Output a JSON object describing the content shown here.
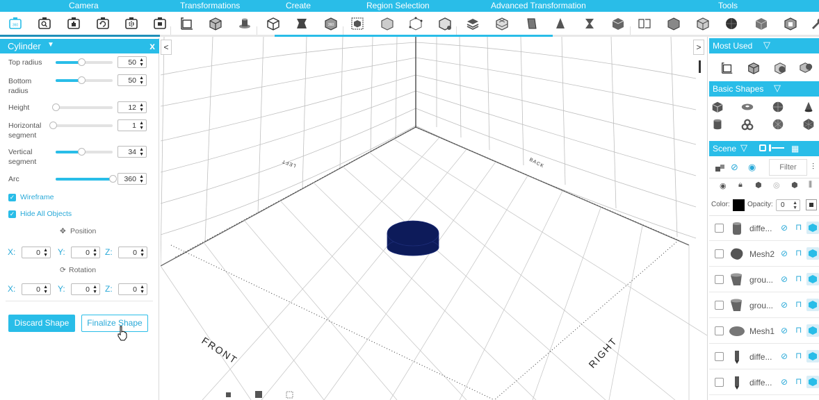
{
  "toolbar": {
    "sections": {
      "camera": "Camera",
      "transformations": "Transformations",
      "create": "Create",
      "region_selection": "Region Selection",
      "advanced_transformation": "Advanced Transformation",
      "tools": "Tools"
    },
    "camera_first_btn": "360"
  },
  "left_panel": {
    "title": "Cylinder",
    "close": "x",
    "props": {
      "top_radius": {
        "label": "Top radius",
        "value": "50",
        "level": 0.45
      },
      "bottom_radius": {
        "label": "Bottom radius",
        "value": "50",
        "level": 0.45
      },
      "height": {
        "label": "Height",
        "value": "12",
        "level": 0.0
      },
      "horizontal_segment": {
        "label": "Horizontal segment",
        "value": "1",
        "level": 0.0
      },
      "vertical_segment": {
        "label": "Vertical segment",
        "value": "34",
        "level": 0.45
      },
      "arc": {
        "label": "Arc",
        "value": "360",
        "level": 1.0
      }
    },
    "wireframe": "Wireframe",
    "hide_all": "Hide All Objects",
    "position": {
      "title": "Position",
      "x_label": "X:",
      "y_label": "Y:",
      "z_label": "Z:",
      "x": "0",
      "y": "0",
      "z": "0"
    },
    "rotation": {
      "title": "Rotation",
      "x_label": "X:",
      "y_label": "Y:",
      "z_label": "Z:",
      "x": "0",
      "y": "0",
      "z": "0"
    },
    "discard": "Discard Shape",
    "finalize": "Finalize Shape"
  },
  "viewport": {
    "labels": {
      "front": "FRONT",
      "right": "RIGHT",
      "left": "LEFT",
      "back": "BACK"
    },
    "left_arrow": "<",
    "right_arrow": ">",
    "shape_color": "#0d1b5a"
  },
  "right_panel": {
    "most_used": "Most Used",
    "basic_shapes": "Basic Shapes",
    "scene": "Scene",
    "filter_placeholder": "Filter",
    "color_label": "Color:",
    "opacity_label": "Opacity:",
    "opacity_value": "0",
    "scene_items": [
      {
        "name": "diffe...",
        "shape": "cylinder-tall"
      },
      {
        "name": "Mesh2",
        "shape": "blob"
      },
      {
        "name": "grou...",
        "shape": "cup"
      },
      {
        "name": "grou...",
        "shape": "cup"
      },
      {
        "name": "Mesh1",
        "shape": "disc"
      },
      {
        "name": "diffe...",
        "shape": "pencil"
      },
      {
        "name": "diffe...",
        "shape": "pencil"
      }
    ]
  },
  "colors": {
    "accent": "#29bde8",
    "accent_dark": "#1f8fb8"
  }
}
